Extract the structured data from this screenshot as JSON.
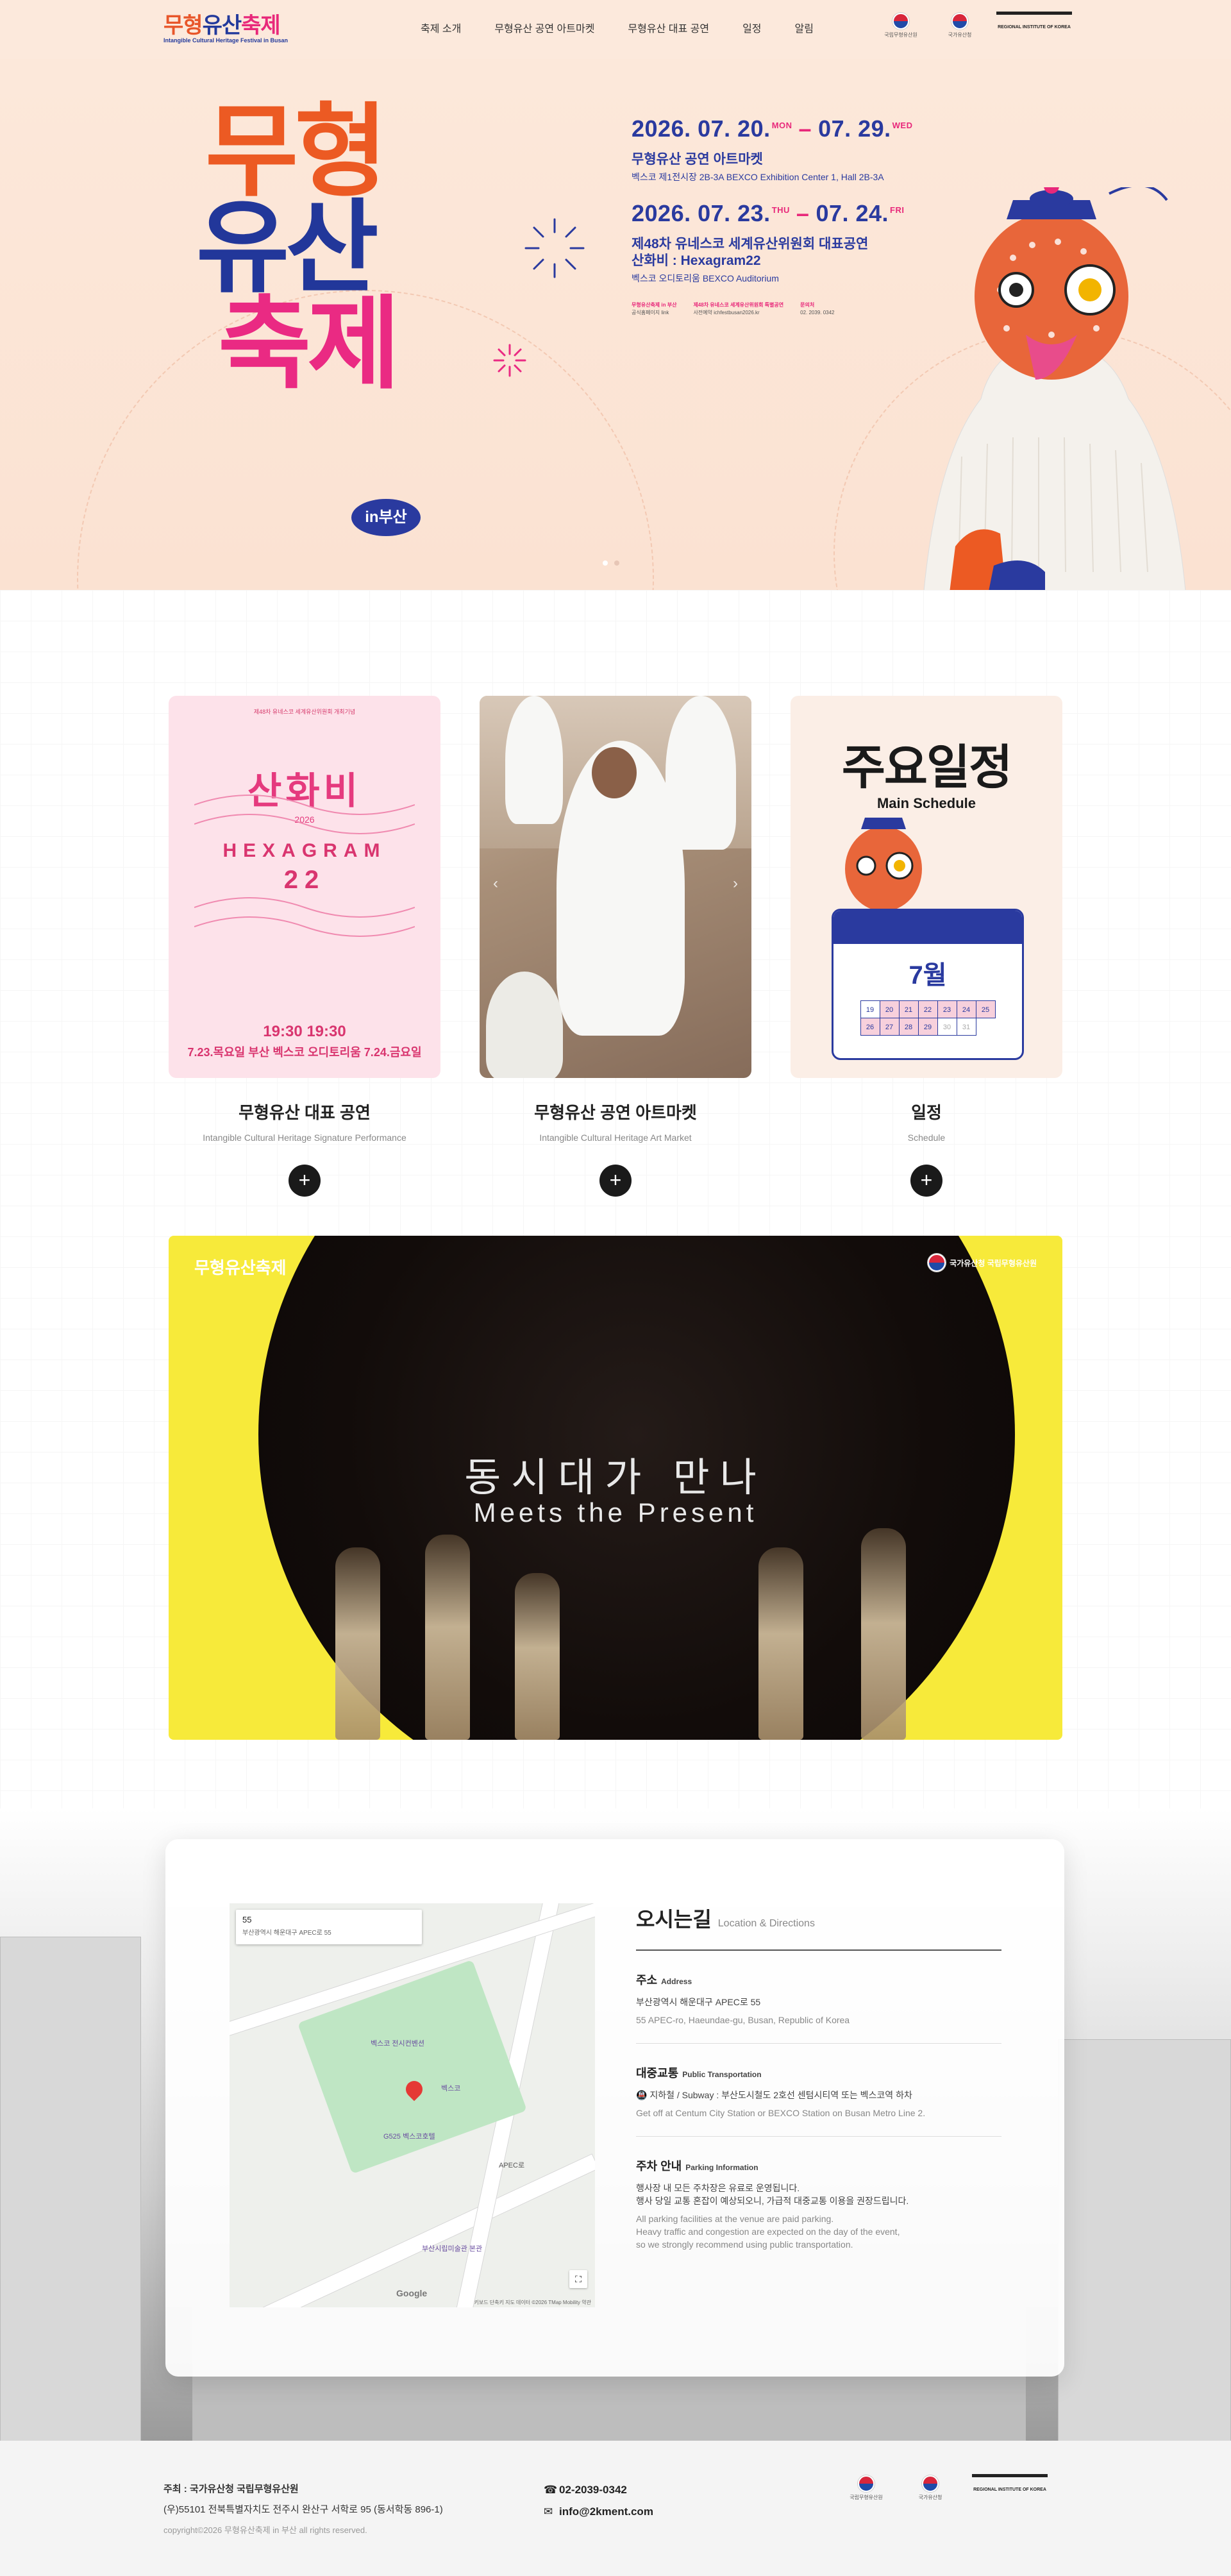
{
  "header": {
    "logo_text_1": "무형",
    "logo_text_2": "유산",
    "logo_text_3": "축제",
    "logo_sub": "Intangible Cultural Heritage Festival in Busan",
    "nav": [
      "축제 소개",
      "무형유산 공연 아트마켓",
      "무형유산 대표 공연",
      "일정",
      "알림"
    ],
    "org_1": "국립무형유산원",
    "org_2": "국가유산청",
    "org_3": "REGIONAL INSTITUTE OF KOREA"
  },
  "hero": {
    "title_1": "무형",
    "title_2": "유산",
    "title_3": "축제",
    "badge": "in부산",
    "event1_date_start": "2026. 07. 20.",
    "event1_dow_start": "MON",
    "event1_date_end": "07. 29.",
    "event1_dow_end": "WED",
    "event1_title": "무형유산 공연 아트마켓",
    "event1_venue": "벡스코 제1전시장 2B-3A  BEXCO Exhibition Center 1, Hall 2B-3A",
    "event2_date_start": "2026. 07. 23.",
    "event2_dow_start": "THU",
    "event2_date_end": "07. 24.",
    "event2_dow_end": "FRI",
    "event2_title_1": "제48차 유네스코 세계유산위원회 대표공연",
    "event2_title_2": "산화비 : Hexagram22",
    "event2_venue": "벡스코 오디토리움 BEXCO Auditorium",
    "contacts": [
      {
        "t": "무형유산축제 in 부산",
        "v": "공식홈페이지 link"
      },
      {
        "t": "제48차 유네스코 세계유산위원회 특별공연",
        "v": "사전예약 ichfestbusan2026.kr"
      },
      {
        "t": "문의처",
        "v": "02. 2039. 0342"
      }
    ]
  },
  "cards": [
    {
      "title": "무형유산 대표 공연",
      "sub": "Intangible Cultural Heritage Signature Performance"
    },
    {
      "title": "무형유산 공연 아트마켓",
      "sub": "Intangible Cultural Heritage Art Market"
    },
    {
      "title": "일정",
      "sub": "Schedule"
    }
  ],
  "poster": {
    "head": "제48차 유네스코 세계유산위원회 개최기념",
    "big": "산화비",
    "year": "2026",
    "hexa": "HEXAGRAM",
    "num": "22",
    "dates": "7.23.목요일  부산 벡스코 오디토리움  7.24.금요일",
    "time": "19:30                                   19:30"
  },
  "schedule_card": {
    "title": "주요일정",
    "sub": "Main Schedule",
    "month": "7월",
    "days": [
      "19",
      "20",
      "21",
      "22",
      "23",
      "24",
      "25",
      "26",
      "27",
      "28",
      "29",
      "30",
      "31"
    ]
  },
  "video": {
    "text_ko": "동시대가 만나",
    "text_en": "Meets the Present",
    "logo_left": "무형유산축제",
    "logo_right": "국가유산청 국립무형유산원"
  },
  "location": {
    "title": "오시는길",
    "title_en": "Location & Directions",
    "address_h": "주소",
    "address_en": "Address",
    "address_ko": "부산광역시 해운대구 APEC로 55",
    "address_eng": "55 APEC-ro, Haeundae-gu, Busan, Republic of Korea",
    "transport_h": "대중교통",
    "transport_en": "Public Transportation",
    "transport_ko": "지하철 / Subway : 부산도시철도 2호선 센텀시티역 또는 벡스코역 하차",
    "transport_eng": "Get off at Centum City Station or BEXCO Station on Busan Metro Line 2.",
    "parking_h": "주차 안내",
    "parking_en": "Parking Information",
    "parking_ko_1": "행사장 내 모든 주차장은 유료로 운영됩니다.",
    "parking_ko_2": "행사 당일 교통 혼잡이 예상되오니, 가급적 대중교통 이용을 권장드립니다.",
    "parking_eng_1": "All parking facilities at the venue are paid parking.",
    "parking_eng_2": "Heavy traffic and congestion are expected on the day of the event,",
    "parking_eng_3": "so we strongly recommend using public transportation.",
    "map_num": "55",
    "map_addr": "부산광역시 해운대구 APEC로 55",
    "map_label_1": "벡스코 전시컨벤션",
    "map_label_2": "벡스코",
    "map_label_3": "G525 벡스코호텔",
    "map_label_4": "부산시립미술관 본관",
    "map_label_5": "APEC로",
    "map_google": "Google",
    "map_foot": "키보드 단축키   지도 데이터 ©2026 TMap Mobility   약관"
  },
  "footer": {
    "host": "주최 : 국가유산청 국립무형유산원",
    "address": "(우)55101 전북특별자치도 전주시 완산구 서학로 95 (동서학동 896-1)",
    "copyright": "copyright©2026 무형유산축제 in 부산 all rights reserved.",
    "phone": "02-2039-0342",
    "email": "info@2kment.com",
    "phone_icon": "☎",
    "email_icon": "✉"
  }
}
